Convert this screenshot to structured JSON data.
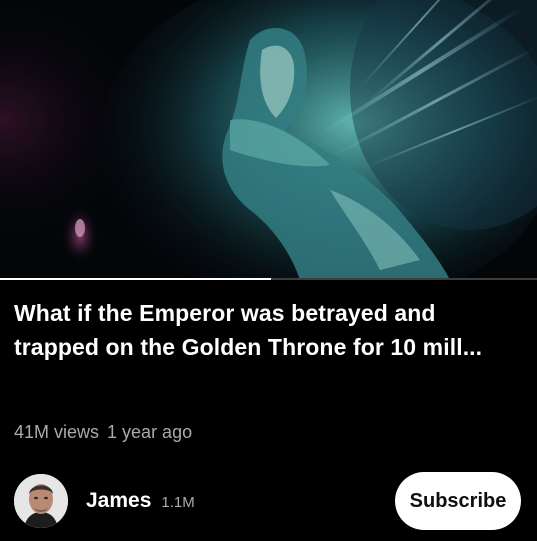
{
  "video": {
    "title": "What if the Emperor was betrayed and trapped on the Golden Throne for 10 mill...",
    "views": "41M views",
    "age": "1 year ago",
    "progress_fraction": 0.505
  },
  "channel": {
    "name": "James",
    "subscribers": "1.1M",
    "subscribe_label": "Subscribe"
  },
  "colors": {
    "background": "#000000",
    "progress_played": "#ffffff",
    "progress_track": "#3d3d3d",
    "meta_text": "#aaaaaa"
  }
}
